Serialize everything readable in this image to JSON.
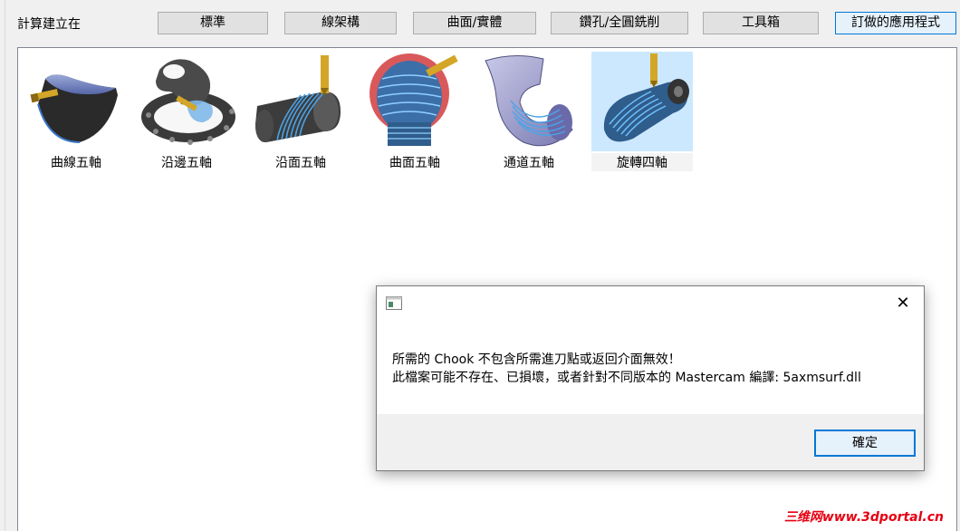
{
  "topbar": {
    "label": "計算建立在",
    "tabs": [
      {
        "label": "標準"
      },
      {
        "label": "線架構"
      },
      {
        "label": "曲面/實體"
      },
      {
        "label": "鑽孔/全圓銑削"
      },
      {
        "label": "工具箱"
      },
      {
        "label": "訂做的應用程式",
        "selected": true
      }
    ]
  },
  "tools": [
    {
      "label": "曲線五軸",
      "icon": "curve-5axis-icon"
    },
    {
      "label": "沿邊五軸",
      "icon": "swarf-5axis-icon"
    },
    {
      "label": "沿面五軸",
      "icon": "flowline-5axis-icon"
    },
    {
      "label": "曲面五軸",
      "icon": "multisurface-5axis-icon"
    },
    {
      "label": "通道五軸",
      "icon": "port-5axis-icon"
    },
    {
      "label": "旋轉四軸",
      "icon": "rotary-4axis-icon",
      "selected": true
    }
  ],
  "dialog": {
    "line1": "所需的 Chook 不包含所需進刀點或返回介面無效！",
    "line2": "此檔案可能不存在、已損壞，或者針對不同版本的 Mastercam 編譯: 5axmsurf.dll",
    "ok_label": "確定",
    "close_glyph": "✕"
  },
  "watermark": "三维网www.3dportal.cn",
  "colors": {
    "accent": "#0078d7",
    "selected_bg": "#cce8ff",
    "watermark": "#e60012"
  }
}
